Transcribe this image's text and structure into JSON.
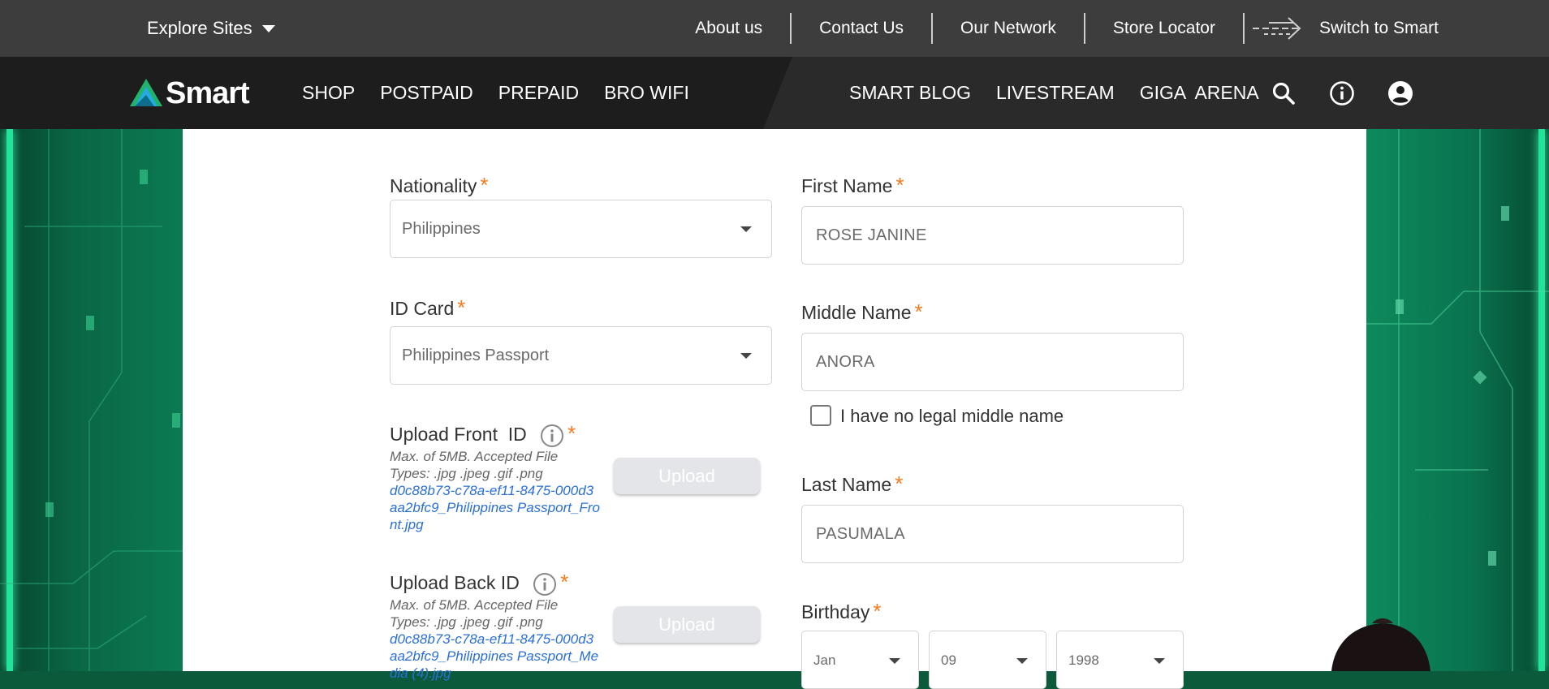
{
  "topbar": {
    "explore_label": "Explore Sites",
    "links": [
      "About us",
      "Contact Us",
      "Our Network",
      "Store Locator"
    ],
    "switch_label": "Switch to Smart"
  },
  "nav": {
    "logo_text": "Smart",
    "left_items": [
      "SHOP",
      "POSTPAID",
      "PREPAID",
      "BRO WIFI"
    ],
    "right_items": [
      "SMART BLOG",
      "LIVESTREAM",
      "GIGA  ARENA"
    ],
    "icons": [
      "search-icon",
      "info-icon",
      "account-icon"
    ]
  },
  "form": {
    "nationality": {
      "label": "Nationality",
      "value": "Philippines"
    },
    "id_card": {
      "label": "ID Card",
      "value": "Philippines Passport"
    },
    "upload_front": {
      "label": "Upload Front  ID",
      "hint": "Max. of 5MB. Accepted File Types: .jpg .jpeg .gif .png",
      "file_name": "d0c88b73-c78a-ef11-8475-000d3aa2bfc9_Philippines Passport_Front.jpg",
      "button": "Upload"
    },
    "upload_back": {
      "label": "Upload Back ID",
      "hint": "Max. of 5MB. Accepted File Types: .jpg .jpeg .gif .png",
      "file_name": "d0c88b73-c78a-ef11-8475-000d3aa2bfc9_Philippines Passport_Media (4).jpg",
      "button": "Upload"
    },
    "first_name": {
      "label": "First Name",
      "value": "ROSE JANINE"
    },
    "middle_name": {
      "label": "Middle Name",
      "value": "ANORA"
    },
    "no_middle_name": {
      "label": "I have no legal middle name",
      "checked": false
    },
    "last_name": {
      "label": "Last Name",
      "value": "PASUMALA"
    },
    "birthday": {
      "label": "Birthday",
      "month": "Jan",
      "day": "09",
      "year": "1998"
    },
    "required_mark": "*"
  },
  "colors": {
    "topbar_bg": "#3d3d3d",
    "nav_bg": "#1d1d1d",
    "accent_required": "#f47a20",
    "file_link": "#2a6fd6",
    "brand_green": "#0b7a52"
  }
}
